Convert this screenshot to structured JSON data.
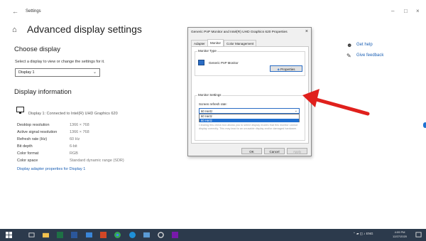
{
  "app": {
    "back_glyph": "←",
    "title": "Settings",
    "minimize_glyph": "–",
    "maximize_glyph": "□",
    "close_glyph": "×"
  },
  "page": {
    "home_glyph": "⌂",
    "title": "Advanced display settings",
    "choose_display_heading": "Choose display",
    "choose_display_hint": "Select a display to view or change the settings for it.",
    "display_select_value": "Display 1",
    "display_info_heading": "Display information",
    "monitor_caption": "Display 1: Connected to Intel(R) UHD Graphics 620",
    "info_rows": [
      {
        "key": "Desktop resolution",
        "value": "1366 × 768"
      },
      {
        "key": "Active signal resolution",
        "value": "1366 × 768"
      },
      {
        "key": "Refresh rate (Hz)",
        "value": "60 Hz"
      },
      {
        "key": "Bit depth",
        "value": "6-bit"
      },
      {
        "key": "Color format",
        "value": "RGB"
      },
      {
        "key": "Color space",
        "value": "Standard dynamic range (SDR)"
      }
    ],
    "adapter_link": "Display adapter properties for Display 1"
  },
  "side_links": {
    "help": "Get help",
    "feedback": "Give feedback"
  },
  "dialog": {
    "title": "Generic PnP Monitor and Intel(R) UHD Graphics 620 Properties",
    "close_glyph": "×",
    "tabs": [
      "Adapter",
      "Monitor",
      "Color Management"
    ],
    "active_tab": "Monitor",
    "monitor_type_label": "Monitor Type",
    "monitor_name": "Generic PnP Monitor",
    "properties_button": "Properties",
    "monitor_settings_label": "Monitor Settings",
    "refresh_rate_label": "Screen refresh rate:",
    "refresh_rate_value": "60 Hertz",
    "refresh_options": [
      "60 Hertz",
      "60 Hertz"
    ],
    "selected_option_index": 1,
    "warning_text": "Clearing this check box allows you to select display modes that this monitor cannot display correctly. This may lead to an unusable display and/or damaged hardware.",
    "ok_button": "OK",
    "cancel_button": "Cancel",
    "apply_button": "Apply"
  },
  "taskbar": {
    "tray_items": "⌃ ▰ ◫ ♪ ENG",
    "time": "4:09 PM",
    "date": "12/27/2020"
  },
  "colors": {
    "accent": "#1a5fb4",
    "arrow": "#e0201c",
    "taskbar": "#2c3a4c",
    "selection": "#1f6fd1"
  }
}
